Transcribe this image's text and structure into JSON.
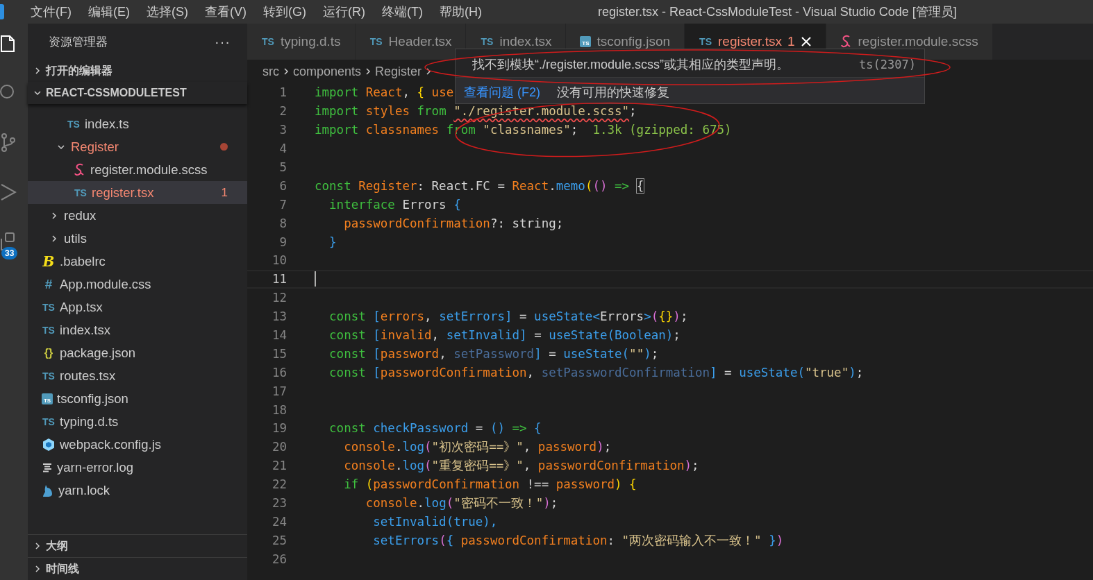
{
  "menu_bar": {
    "items": [
      "文件(F)",
      "编辑(E)",
      "选择(S)",
      "查看(V)",
      "转到(G)",
      "运行(R)",
      "终端(T)",
      "帮助(H)"
    ],
    "title": "register.tsx - React-CssModuleTest - Visual Studio Code [管理员]"
  },
  "activity_bar": [
    {
      "kind": "explorer",
      "selected": true
    },
    {
      "kind": "search",
      "selected": false
    },
    {
      "kind": "source-control",
      "selected": false
    },
    {
      "kind": "run",
      "selected": false
    },
    {
      "kind": "extensions",
      "selected": false,
      "badge": "33"
    }
  ],
  "sidebar": {
    "title": "资源管理器",
    "more": "···",
    "sections": [
      {
        "title": "打开的编辑器",
        "expanded": false
      },
      {
        "title": "REACT-CSSMODULETEST",
        "expanded": true,
        "tree": [
          {
            "kind": "group",
            "children": [
              {
                "kind": "group",
                "children": [
                  {
                    "kind": "ts",
                    "name": "index.ts",
                    "glyph": "TS",
                    "selected": false,
                    "error": false
                  },
                  {
                    "kind": "folder",
                    "name": "Register",
                    "expanded": true,
                    "selected": false,
                    "error": true,
                    "children": [
                      {
                        "kind": "scss",
                        "name": "register.module.scss",
                        "selected": false,
                        "error": false
                      },
                      {
                        "kind": "ts",
                        "name": "register.tsx",
                        "glyph": "TS",
                        "selected": true,
                        "error": true,
                        "problems": "1"
                      }
                    ]
                  }
                ]
              },
              {
                "kind": "folder",
                "name": "redux",
                "expanded": false,
                "selected": false,
                "error": false
              },
              {
                "kind": "folder",
                "name": "utils",
                "expanded": false,
                "selected": false,
                "error": false
              }
            ]
          },
          {
            "kind": "babel",
            "name": ".babelrc",
            "glyph": "B",
            "selected": false,
            "error": false
          },
          {
            "kind": "css",
            "name": "App.module.css",
            "glyph": "#",
            "selected": false,
            "error": false
          },
          {
            "kind": "ts",
            "name": "App.tsx",
            "glyph": "TS",
            "selected": false,
            "error": false
          },
          {
            "kind": "ts",
            "name": "index.tsx",
            "glyph": "TS",
            "selected": false,
            "error": false
          },
          {
            "kind": "json",
            "name": "package.json",
            "glyph": "{}",
            "selected": false,
            "error": false
          },
          {
            "kind": "ts",
            "name": "routes.tsx",
            "glyph": "TS",
            "selected": false,
            "error": false
          },
          {
            "kind": "tsconfig",
            "name": "tsconfig.json",
            "glyph": "TS",
            "selected": false,
            "error": false
          },
          {
            "kind": "ts",
            "name": "typing.d.ts",
            "glyph": "TS",
            "selected": false,
            "error": false
          },
          {
            "kind": "webpack",
            "name": "webpack.config.js",
            "selected": false,
            "error": false
          },
          {
            "kind": "log",
            "name": "yarn-error.log",
            "selected": false,
            "error": false
          },
          {
            "kind": "yarn",
            "name": "yarn.lock",
            "selected": false,
            "error": false
          }
        ]
      },
      {
        "title": "大纲",
        "expanded": false
      },
      {
        "title": "时间线",
        "expanded": false
      }
    ]
  },
  "tabs": [
    {
      "label": "typing.d.ts",
      "kind": "ts",
      "glyph": "TS",
      "selected": false,
      "error": false
    },
    {
      "label": "Header.tsx",
      "kind": "ts",
      "glyph": "TS",
      "selected": false,
      "error": false
    },
    {
      "label": "index.tsx",
      "kind": "ts",
      "glyph": "TS",
      "selected": false,
      "error": false
    },
    {
      "label": "tsconfig.json",
      "kind": "tsconfig",
      "glyph": "TS",
      "selected": false,
      "error": false
    },
    {
      "label": "register.tsx",
      "kind": "ts",
      "glyph": "TS",
      "selected": true,
      "error": true,
      "problems": "1"
    },
    {
      "label": "register.module.scss",
      "kind": "scss",
      "selected": false,
      "error": false
    }
  ],
  "breadcrumb": [
    "src",
    "components",
    "Register"
  ],
  "editor": {
    "lines": [
      {
        "number": "1",
        "current": false,
        "tokens": [
          {
            "text": "import ",
            "kind": "kw"
          },
          {
            "text": "React",
            "kind": "var"
          },
          {
            "text": ", ",
            "kind": "p"
          },
          {
            "text": "{ ",
            "kind": "y"
          },
          {
            "text": "use",
            "kind": "var"
          }
        ]
      },
      {
        "number": "2",
        "current": false,
        "tokens": [
          {
            "text": "import ",
            "kind": "kw"
          },
          {
            "text": "styles ",
            "kind": "var"
          },
          {
            "text": "from ",
            "kind": "kw"
          },
          {
            "text": "\"./register.module.scss\"",
            "kind": "str-err"
          },
          {
            "text": ";",
            "kind": "p"
          }
        ]
      },
      {
        "number": "3",
        "current": false,
        "tokens": [
          {
            "text": "import ",
            "kind": "kw"
          },
          {
            "text": "classnames ",
            "kind": "var"
          },
          {
            "text": "from ",
            "kind": "kw"
          },
          {
            "text": "\"classnames\"",
            "kind": "str"
          },
          {
            "text": ";  ",
            "kind": "p"
          },
          {
            "text": "1.3k (gzipped: 675)",
            "kind": "cost"
          }
        ]
      },
      {
        "number": "4",
        "current": false
      },
      {
        "number": "5",
        "current": false
      },
      {
        "number": "6",
        "current": false,
        "tokens": [
          {
            "text": "const ",
            "kind": "kw"
          },
          {
            "text": "Register",
            "kind": "var"
          },
          {
            "text": ": React.FC = ",
            "kind": "p"
          },
          {
            "text": "React",
            "kind": "var"
          },
          {
            "text": ".",
            "kind": "p"
          },
          {
            "text": "memo",
            "kind": "fn"
          },
          {
            "text": "(",
            "kind": "y"
          },
          {
            "text": "() ",
            "kind": "m"
          },
          {
            "text": "=> ",
            "kind": "kw"
          },
          {
            "text": "{",
            "kind": "bm"
          }
        ]
      },
      {
        "number": "7",
        "current": false,
        "tokens": [
          {
            "text": "  interface",
            "kind": "kw"
          },
          {
            "text": " Errors ",
            "kind": "p"
          },
          {
            "text": "{",
            "kind": "fn"
          }
        ]
      },
      {
        "number": "8",
        "current": false,
        "tokens": [
          {
            "text": "    passwordConfirmation",
            "kind": "var"
          },
          {
            "text": "?: string;",
            "kind": "p"
          }
        ]
      },
      {
        "number": "9",
        "current": false,
        "tokens": [
          {
            "text": "  }",
            "kind": "fn"
          }
        ]
      },
      {
        "number": "10",
        "current": false
      },
      {
        "number": "11",
        "current": true
      },
      {
        "number": "12",
        "current": false
      },
      {
        "number": "13",
        "current": false,
        "tokens": [
          {
            "text": "  const ",
            "kind": "kw"
          },
          {
            "text": "[",
            "kind": "fn"
          },
          {
            "text": "errors",
            "kind": "var"
          },
          {
            "text": ", ",
            "kind": "p"
          },
          {
            "text": "setErrors]",
            "kind": "fn"
          },
          {
            "text": " = ",
            "kind": "p"
          },
          {
            "text": "useState<",
            "kind": "fn"
          },
          {
            "text": "Errors",
            "kind": "p"
          },
          {
            "text": ">",
            "kind": "fn"
          },
          {
            "text": "(",
            "kind": "m"
          },
          {
            "text": "{}",
            "kind": "y"
          },
          {
            "text": ")",
            "kind": "m"
          },
          {
            "text": ";",
            "kind": "p"
          }
        ]
      },
      {
        "number": "14",
        "current": false,
        "tokens": [
          {
            "text": "  const ",
            "kind": "kw"
          },
          {
            "text": "[",
            "kind": "fn"
          },
          {
            "text": "invalid",
            "kind": "var"
          },
          {
            "text": ", ",
            "kind": "p"
          },
          {
            "text": "setInvalid]",
            "kind": "fn"
          },
          {
            "text": " = ",
            "kind": "p"
          },
          {
            "text": "useState(Boolean)",
            "kind": "fn"
          },
          {
            "text": ";",
            "kind": "p"
          }
        ]
      },
      {
        "number": "15",
        "current": false,
        "tokens": [
          {
            "text": "  const ",
            "kind": "kw"
          },
          {
            "text": "[",
            "kind": "fn"
          },
          {
            "text": "password",
            "kind": "var"
          },
          {
            "text": ", ",
            "kind": "p"
          },
          {
            "text": "setPassword",
            "kind": "dim"
          },
          {
            "text": "]",
            "kind": "fn"
          },
          {
            "text": " = ",
            "kind": "p"
          },
          {
            "text": "useState(",
            "kind": "fn"
          },
          {
            "text": "\"\"",
            "kind": "str"
          },
          {
            "text": ")",
            "kind": "fn"
          },
          {
            "text": ";",
            "kind": "p"
          }
        ]
      },
      {
        "number": "16",
        "current": false,
        "tokens": [
          {
            "text": "  const ",
            "kind": "kw"
          },
          {
            "text": "[",
            "kind": "fn"
          },
          {
            "text": "passwordConfirmation",
            "kind": "var"
          },
          {
            "text": ", ",
            "kind": "p"
          },
          {
            "text": "setPasswordConfirmation",
            "kind": "dim"
          },
          {
            "text": "]",
            "kind": "fn"
          },
          {
            "text": " = ",
            "kind": "p"
          },
          {
            "text": "useState(",
            "kind": "fn"
          },
          {
            "text": "\"true\"",
            "kind": "str"
          },
          {
            "text": ")",
            "kind": "fn"
          },
          {
            "text": ";",
            "kind": "p"
          }
        ]
      },
      {
        "number": "17",
        "current": false
      },
      {
        "number": "18",
        "current": false
      },
      {
        "number": "19",
        "current": false,
        "tokens": [
          {
            "text": "  const ",
            "kind": "kw"
          },
          {
            "text": "checkPassword",
            "kind": "fn"
          },
          {
            "text": " = ",
            "kind": "p"
          },
          {
            "text": "() ",
            "kind": "fn"
          },
          {
            "text": "=> ",
            "kind": "kw"
          },
          {
            "text": "{",
            "kind": "fn"
          }
        ]
      },
      {
        "number": "20",
        "current": false,
        "tokens": [
          {
            "text": "    console",
            "kind": "var"
          },
          {
            "text": ".",
            "kind": "p"
          },
          {
            "text": "log",
            "kind": "fn"
          },
          {
            "text": "(",
            "kind": "m"
          },
          {
            "text": "\"初次密码==》\"",
            "kind": "str"
          },
          {
            "text": ", ",
            "kind": "p"
          },
          {
            "text": "password",
            "kind": "var"
          },
          {
            "text": ")",
            "kind": "m"
          },
          {
            "text": ";",
            "kind": "p"
          }
        ]
      },
      {
        "number": "21",
        "current": false,
        "tokens": [
          {
            "text": "    console",
            "kind": "var"
          },
          {
            "text": ".",
            "kind": "p"
          },
          {
            "text": "log",
            "kind": "fn"
          },
          {
            "text": "(",
            "kind": "m"
          },
          {
            "text": "\"重复密码==》\"",
            "kind": "str"
          },
          {
            "text": ", ",
            "kind": "p"
          },
          {
            "text": "passwordConfirmation",
            "kind": "var"
          },
          {
            "text": ")",
            "kind": "m"
          },
          {
            "text": ";",
            "kind": "p"
          }
        ]
      },
      {
        "number": "22",
        "current": false,
        "tokens": [
          {
            "text": "    if ",
            "kind": "kw"
          },
          {
            "text": "(",
            "kind": "y"
          },
          {
            "text": "passwordConfirmation",
            "kind": "var"
          },
          {
            "text": " !== ",
            "kind": "p"
          },
          {
            "text": "password",
            "kind": "var"
          },
          {
            "text": ") {",
            "kind": "y"
          }
        ]
      },
      {
        "number": "23",
        "current": false,
        "tokens": [
          {
            "text": "       console",
            "kind": "var"
          },
          {
            "text": ".",
            "kind": "p"
          },
          {
            "text": "log",
            "kind": "fn"
          },
          {
            "text": "(",
            "kind": "m"
          },
          {
            "text": "\"密码不一致！\"",
            "kind": "str"
          },
          {
            "text": ")",
            "kind": "m"
          },
          {
            "text": ";",
            "kind": "p"
          }
        ]
      },
      {
        "number": "24",
        "current": false,
        "tokens": [
          {
            "text": "        setInvalid(true),",
            "kind": "fn"
          }
        ]
      },
      {
        "number": "25",
        "current": false,
        "tokens": [
          {
            "text": "        setErrors",
            "kind": "fn"
          },
          {
            "text": "(",
            "kind": "m"
          },
          {
            "text": "{ ",
            "kind": "fn"
          },
          {
            "text": "passwordConfirmation",
            "kind": "var"
          },
          {
            "text": ": ",
            "kind": "p"
          },
          {
            "text": "\"两次密码输入不一致！\" ",
            "kind": "str"
          },
          {
            "text": "}",
            "kind": "fn"
          },
          {
            "text": ")",
            "kind": "m"
          }
        ]
      },
      {
        "number": "26",
        "current": false
      }
    ]
  },
  "hover": {
    "message": "找不到模块“./register.module.scss”或其相应的类型声明。",
    "code": "ts(2307)",
    "link": "查看问题 (F2)",
    "note": "没有可用的快速修复"
  }
}
